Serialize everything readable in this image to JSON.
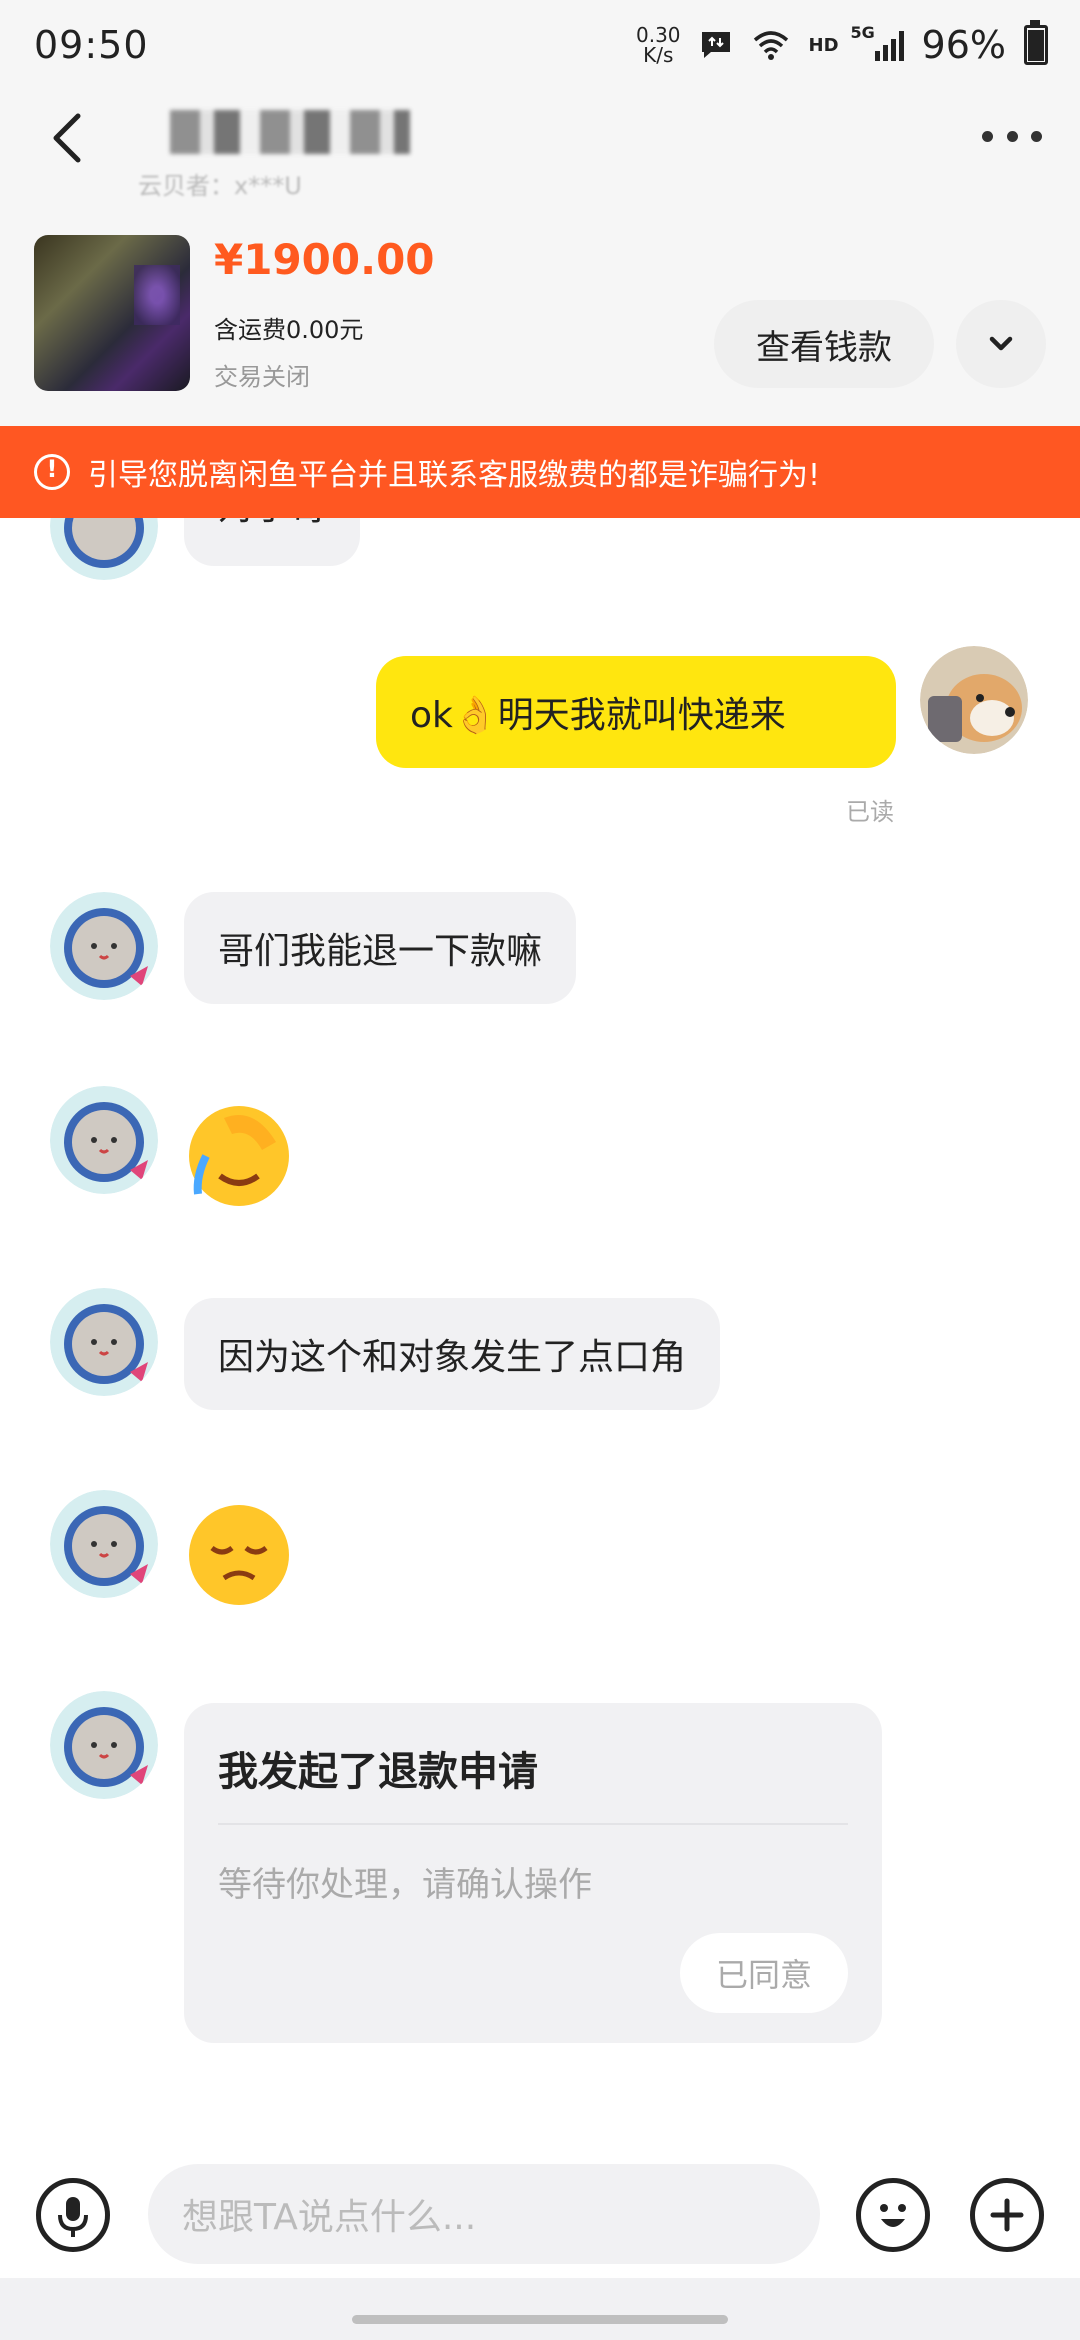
{
  "status_bar": {
    "time": "09:50",
    "net_speed_value": "0.30",
    "net_speed_unit": "K/s",
    "hd": "HD",
    "network": "5G",
    "battery": "96%"
  },
  "header": {
    "subtitle": "云贝者：x***U"
  },
  "product": {
    "price": "¥1900.00",
    "shipping": "含运费0.00元",
    "status": "交易关闭",
    "view_money_button": "查看钱款"
  },
  "warning": {
    "text": "引导您脱离闲鱼平台并且联系客服缴费的都是诈骗行为!"
  },
  "messages": {
    "m0_partial": "对了哥",
    "m1_text": "ok👌明天我就叫快递来",
    "m1_read": "已读",
    "m2_text": "哥们我能退一下款嘛",
    "m3_emoji": "facepalm-crying-emoji",
    "m4_text": "因为这个和对象发生了点口角",
    "m5_emoji": "sad-pensive-emoji"
  },
  "refund_card": {
    "title": "我发起了退款申请",
    "desc": "等待你处理，请确认操作",
    "button": "已同意"
  },
  "input": {
    "placeholder": "想跟TA说点什么..."
  },
  "colors": {
    "price": "#ff5a1f",
    "warning_bg": "#ff5722",
    "my_bubble": "#ffe60f",
    "other_bubble": "#f1f1f3"
  }
}
